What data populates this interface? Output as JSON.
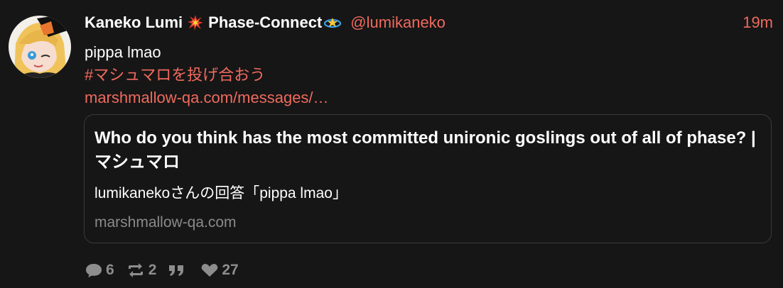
{
  "post": {
    "author": {
      "display_name_first": "Kaneko Lumi",
      "display_name_second": "Phase-Connect",
      "handle": "@lumikaneko",
      "emoji_1": "collision-emoji",
      "emoji_2": "shooting-star-emoji"
    },
    "timestamp": "19m",
    "body": {
      "line1": "pippa lmao",
      "hashtag": "#マシュマロを投げ合おう",
      "link": "marshmallow-qa.com/messages/…"
    },
    "card": {
      "title": "Who do you think has the most committed unironic goslings out of all of phase? | マシュマロ",
      "description": "lumikanekoさんの回答「pippa lmao」",
      "domain": "marshmallow-qa.com"
    },
    "actions": {
      "replies": "6",
      "reposts": "2",
      "quotes_icon": "quote-icon",
      "likes": "27"
    }
  },
  "colors": {
    "background": "#161616",
    "accent": "#ef6a5e",
    "muted": "#8d8d8d",
    "border": "#3b3b3b"
  }
}
